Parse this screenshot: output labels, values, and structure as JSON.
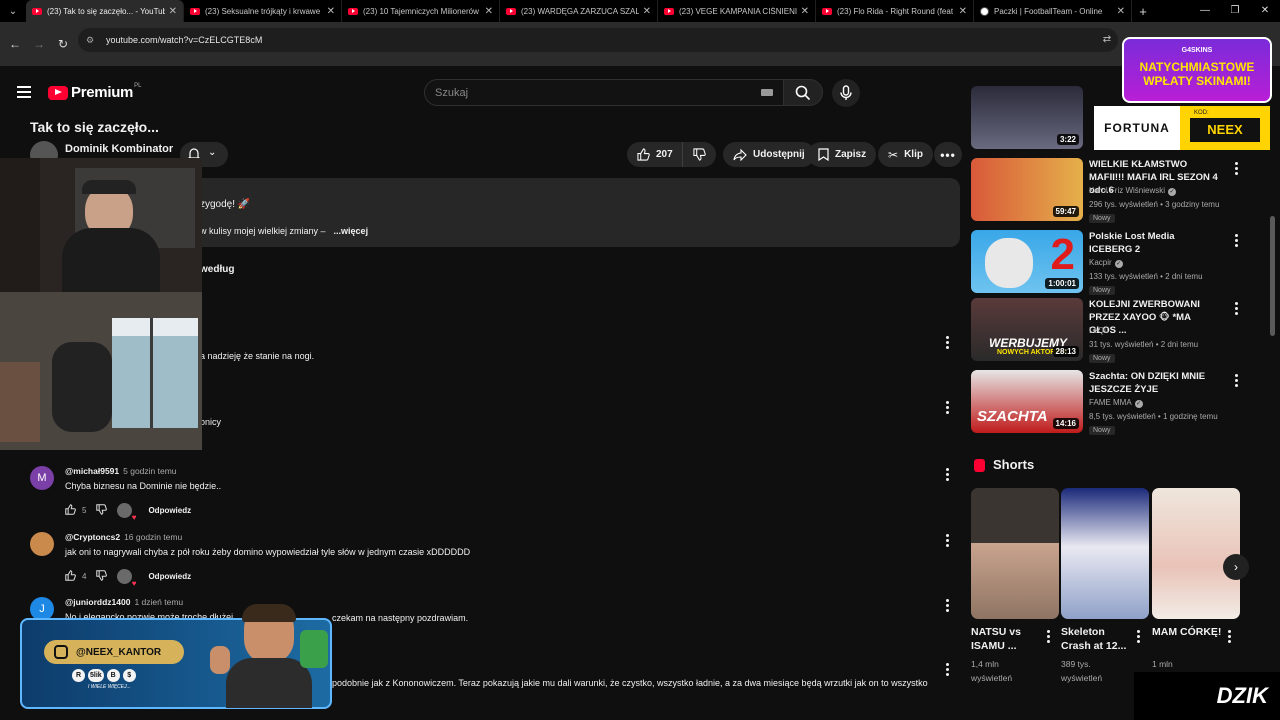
{
  "browser": {
    "tabs": [
      {
        "title": "(23) Tak to się zaczęło... - YouTube",
        "active": true,
        "icon": "youtube-icon"
      },
      {
        "title": "(23) Seksualne trójkąty i krwawe",
        "active": false,
        "icon": "youtube-icon"
      },
      {
        "title": "(23) 10 Tajemniczych Milionerów",
        "active": false,
        "icon": "youtube-icon"
      },
      {
        "title": "(23) WARDĘGA ZARZUCA SZAL",
        "active": false,
        "icon": "youtube-icon"
      },
      {
        "title": "(23) VEGE KAMPANIA CIŚNIENIA",
        "active": false,
        "icon": "youtube-icon"
      },
      {
        "title": "(23) Flo Rida - Right Round (feat",
        "active": false,
        "icon": "youtube-icon"
      },
      {
        "title": "Paczki | FootballTeam - Online",
        "active": false,
        "icon": "football-icon"
      }
    ],
    "url": "youtube.com/watch?v=CzELCGTE8cM"
  },
  "youtube": {
    "logo_word": "Premium",
    "country": "PL",
    "search_placeholder": "Szukaj"
  },
  "video": {
    "title": "Tak to się zaczęło...",
    "channel": "Dominik Kombinator",
    "likes": "207",
    "share_label": "Udostępnij",
    "save_label": "Zapisz",
    "clip_label": "Klip"
  },
  "description": {
    "line1": "zygodę! 🚀",
    "line2": "w kulisy mojej wielkiej zmiany  –",
    "more": "...więcej"
  },
  "comments_sort_partial": "według",
  "partials": {
    "c1": "a nadzieję że stanie na nogi.",
    "c2": "onicy",
    "c6": "podobnie jak z Kononowiczem. Teraz pokazują jakie mu dali warunki, że czystko, wszystko ładnie, a za dwa miesiące będą wrzutki jak on to wszystko",
    "c5_tail": "czekam na następny pozdrawiam."
  },
  "comments": [
    {
      "avatar_letter": "M",
      "avatar_color": "#7b3fa8",
      "author": "@michał9591",
      "time": "5 godzin temu",
      "text": "Chyba biznesu na Dominie nie będzie..",
      "likes": "5",
      "reply": "Odpowiedz"
    },
    {
      "avatar_letter": "",
      "avatar_color": "#c98a4b",
      "author": "@Cryptoncs2",
      "time": "16 godzin temu",
      "text": "jak oni to nagrywali chyba z pół roku żeby domino wypowiedział tyle słów w jednym czasie xDDDDDD",
      "likes": "4",
      "reply": "Odpowiedz"
    },
    {
      "avatar_letter": "J",
      "avatar_color": "#1e88e5",
      "author": "@juniorddz1400",
      "time": "1 dzień temu",
      "text": "No i elegancko pozwie może trochę dłużej",
      "likes": "",
      "reply": ""
    }
  ],
  "related": [
    {
      "title": "",
      "channel": "",
      "meta": "",
      "badge": "",
      "duration": "3:22"
    },
    {
      "title": "WIELKIE KŁAMSTWO MAFII!!! MAFIA IRL SEZON 4 odc.6",
      "channel": "Karol Friz Wiśniewski",
      "meta": "296 tys. wyświetleń • 3 godziny temu",
      "badge": "Nowy",
      "duration": "59:47"
    },
    {
      "title": "Polskie Lost Media ICEBERG 2",
      "channel": "Kacpir",
      "meta": "133 tys. wyświetleń • 2 dni temu",
      "badge": "Nowy",
      "duration": "1:00:01"
    },
    {
      "title": "KOLEJNI ZWERBOWANI PRZEZ XAYOO 🐵 *MA GŁOS ...",
      "channel": "LeQu",
      "meta": "31 tys. wyświetleń • 2 dni temu",
      "badge": "Nowy",
      "duration": "28:13"
    },
    {
      "title": "Szachta: ON DZIĘKI MNIE JESZCZE ŻYJE",
      "channel": "FAME MMA",
      "meta": "8,5 tys. wyświetleń • 1 godzinę temu",
      "badge": "Nowy",
      "duration": "14:16"
    }
  ],
  "thumb_overlays": {
    "t2": "2",
    "t3a": "WERBUJEMY",
    "t3b": "NOWYCH AKTORÓW",
    "t4": "SZACHTA"
  },
  "shorts": {
    "heading": "Shorts",
    "items": [
      {
        "title": "NATSU vs ISAMU ...",
        "views": "1,4 mln wyświetleń"
      },
      {
        "title": "Skeleton Crash at 12...",
        "views": "389 tys. wyświetleń"
      },
      {
        "title": "MAM CÓRKĘ!",
        "views": "1 mln"
      }
    ]
  },
  "overlays": {
    "promo_brand": "G4SKINS",
    "promo_text": "NATYCHMIASTOWE WPŁATY SKINAMI!",
    "fortuna": "FORTUNA",
    "fortuna_code_label": "KOD:",
    "fortuna_code": "NEEX",
    "neex_handle": "@NEEX_KANTOR",
    "neex_coins": [
      "R",
      "5lik",
      "B",
      "$"
    ],
    "neex_more": "I WIELE WIĘCEJ...",
    "dzik": "DZIK"
  },
  "colors": {
    "accent": "#ff0033",
    "bg": "#0f0f0f",
    "chip": "#272727"
  }
}
